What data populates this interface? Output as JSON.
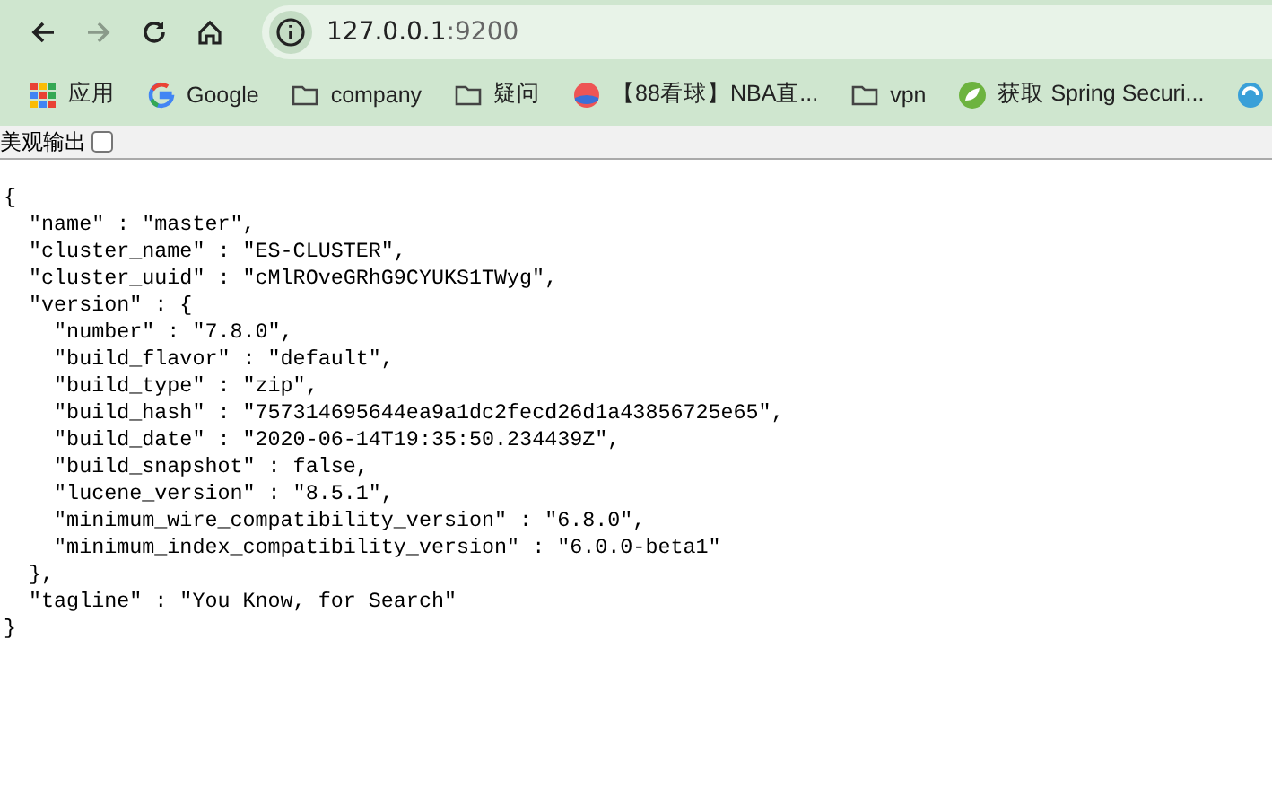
{
  "toolbar": {
    "address": {
      "host": "127.0.0.1",
      "port": ":9200"
    }
  },
  "bookmarks": [
    {
      "kind": "apps",
      "label": "应用"
    },
    {
      "kind": "google",
      "label": "Google"
    },
    {
      "kind": "folder",
      "label": "company"
    },
    {
      "kind": "folder",
      "label": "疑问"
    },
    {
      "kind": "ball",
      "label": "【88看球】NBA直..."
    },
    {
      "kind": "folder",
      "label": "vpn"
    },
    {
      "kind": "leaf",
      "label": "获取 Spring Securi..."
    },
    {
      "kind": "swirl"
    }
  ],
  "pretty_print": {
    "label": "美观输出",
    "checked": false
  },
  "json_lines": [
    {
      "text": "{",
      "children": [
        {
          "text": "\"name\" : \"master\","
        },
        {
          "text": "\"cluster_name\" : \"ES-CLUSTER\","
        },
        {
          "text": "\"cluster_uuid\" : \"cMlROveGRhG9CYUKS1TWyg\","
        },
        {
          "text": "\"version\" : {",
          "children": [
            {
              "text": "\"number\" : \"7.8.0\","
            },
            {
              "text": "\"build_flavor\" : \"default\","
            },
            {
              "text": "\"build_type\" : \"zip\","
            },
            {
              "text": "\"build_hash\" : \"757314695644ea9a1dc2fecd26d1a43856725e65\","
            },
            {
              "text": "\"build_date\" : \"2020-06-14T19:35:50.234439Z\","
            },
            {
              "text": "\"build_snapshot\" : false,"
            },
            {
              "text": "\"lucene_version\" : \"8.5.1\","
            },
            {
              "text": "\"minimum_wire_compatibility_version\" : \"6.8.0\","
            },
            {
              "text": "\"minimum_index_compatibility_version\" : \"6.0.0-beta1\""
            }
          ]
        },
        {
          "text": "},"
        },
        {
          "text": "\"tagline\" : \"You Know, for Search\""
        }
      ]
    },
    {
      "text": "}"
    }
  ]
}
